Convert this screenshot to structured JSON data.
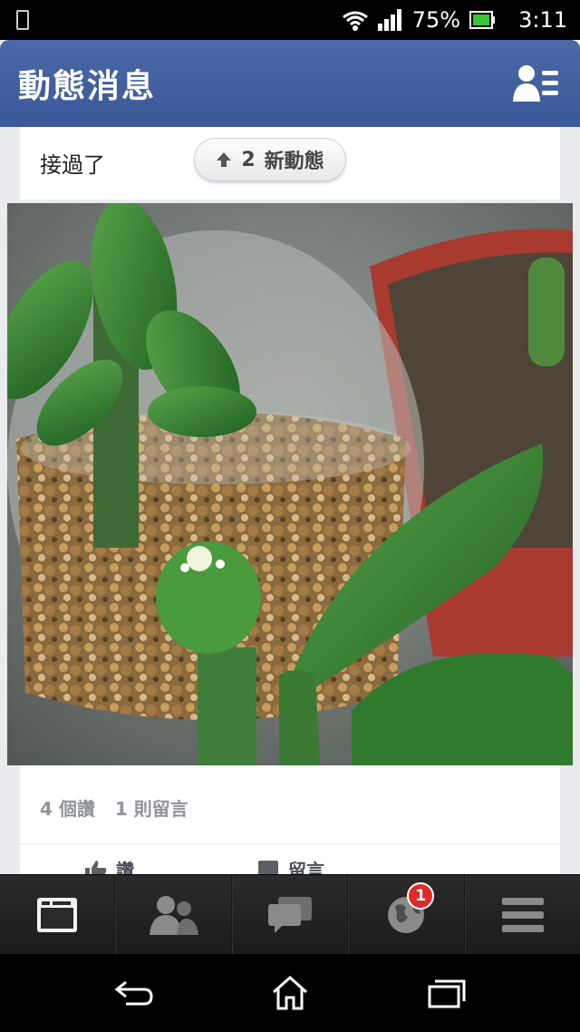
{
  "status_bar": {
    "battery_percent": "75%",
    "time": "3:11",
    "icons": [
      "phone-icon",
      "wifi-icon",
      "signal-icon",
      "battery-icon"
    ]
  },
  "header": {
    "title": "動態消息",
    "friend_requests_icon": "friend-requests-icon"
  },
  "feed": {
    "top_label": "接過了",
    "new_stories": {
      "count": "2",
      "label": "新動態"
    },
    "post": {
      "likes": "4 個讚",
      "comments": "1 則留言",
      "actions": {
        "like": "讚",
        "comment": "留言"
      }
    }
  },
  "tab_bar": {
    "tabs": [
      {
        "name": "news-feed",
        "icon": "news-feed-icon",
        "active": true
      },
      {
        "name": "friend-requests",
        "icon": "friends-icon"
      },
      {
        "name": "messages",
        "icon": "messages-icon"
      },
      {
        "name": "notifications",
        "icon": "globe-icon",
        "badge": "1"
      },
      {
        "name": "more",
        "icon": "menu-icon"
      }
    ]
  },
  "nav_bar": {
    "buttons": [
      "back-icon",
      "home-icon",
      "recent-apps-icon"
    ]
  },
  "colors": {
    "brand_blue": "#3b5998",
    "badge_red": "#e02a2a"
  }
}
